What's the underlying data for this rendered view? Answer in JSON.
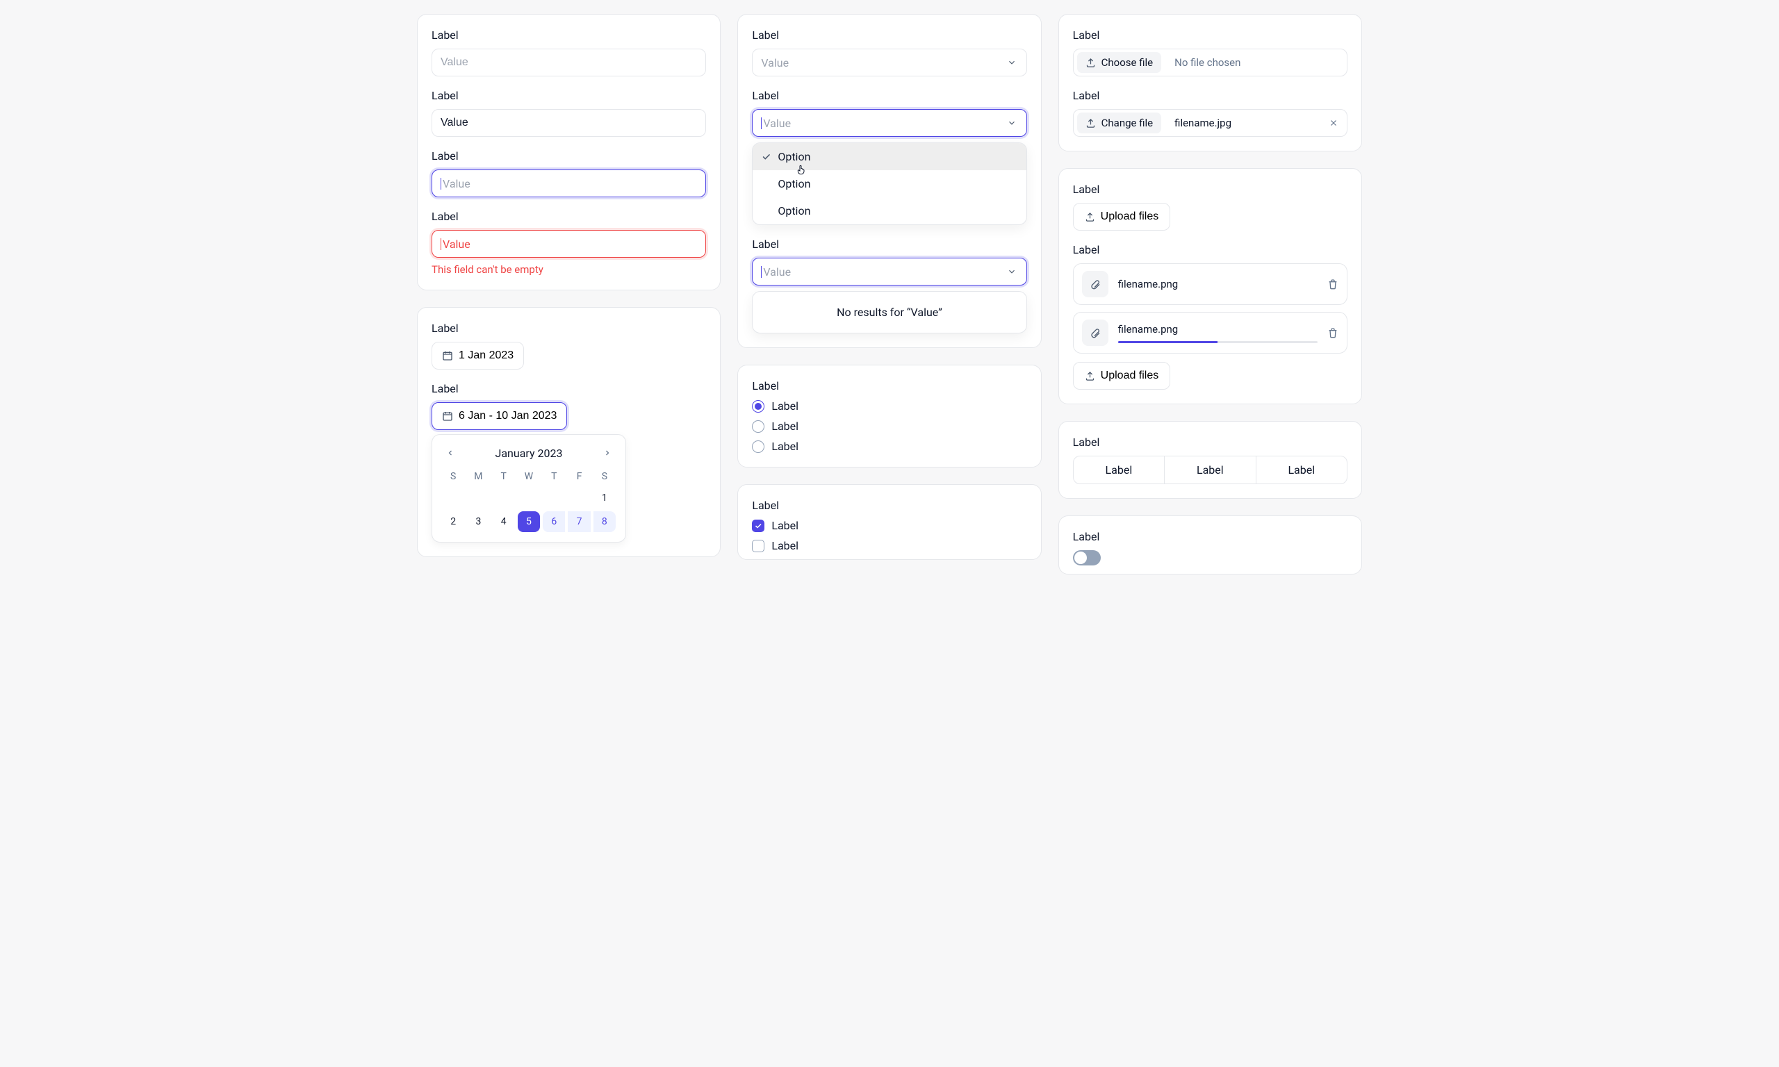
{
  "text_inputs": {
    "placeholder": {
      "label": "Label",
      "placeholder": "Value"
    },
    "filled": {
      "label": "Label",
      "value": "Value"
    },
    "focused": {
      "label": "Label",
      "placeholder": "Value"
    },
    "error": {
      "label": "Label",
      "placeholder": "Value",
      "error_text": "This field can't be empty"
    }
  },
  "date": {
    "single": {
      "label": "Label",
      "value": "1 Jan 2023"
    },
    "range": {
      "label": "Label",
      "value": "6 Jan - 10 Jan 2023"
    },
    "calendar": {
      "title": "January 2023",
      "dow": [
        "S",
        "M",
        "T",
        "W",
        "T",
        "F",
        "S"
      ],
      "visible_days": [
        1,
        2,
        3,
        4,
        5,
        6,
        7,
        8
      ],
      "selected_day": 5,
      "range_days": [
        6,
        7,
        8
      ]
    }
  },
  "selects": {
    "closed": {
      "label": "Label",
      "value": "Value"
    },
    "open": {
      "label": "Label",
      "value": "Value",
      "options": [
        "Option",
        "Option",
        "Option"
      ],
      "selected_idx": 0
    },
    "empty": {
      "label": "Label",
      "value": "Value",
      "no_results_text": "No results for \"Value\""
    }
  },
  "radios": {
    "label": "Label",
    "options": [
      "Label",
      "Label",
      "Label"
    ],
    "selected_idx": 0
  },
  "checkboxes": {
    "label": "Label",
    "items": [
      {
        "label": "Label",
        "checked": true
      },
      {
        "label": "Label",
        "checked": false
      }
    ]
  },
  "file_single": {
    "empty": {
      "label": "Label",
      "button": "Choose file",
      "text": "No file chosen"
    },
    "chosen": {
      "label": "Label",
      "button": "Change file",
      "text": "filename.jpg"
    }
  },
  "file_multi": {
    "empty": {
      "label": "Label",
      "button": "Upload files"
    },
    "list": {
      "label": "Label",
      "button": "Upload files",
      "files": [
        {
          "name": "filename.png",
          "uploading": false
        },
        {
          "name": "filename.png",
          "uploading": true,
          "progress": 50
        }
      ]
    }
  },
  "segmented": {
    "label": "Label",
    "items": [
      "Label",
      "Label",
      "Label"
    ]
  },
  "toggle": {
    "label": "Label"
  }
}
